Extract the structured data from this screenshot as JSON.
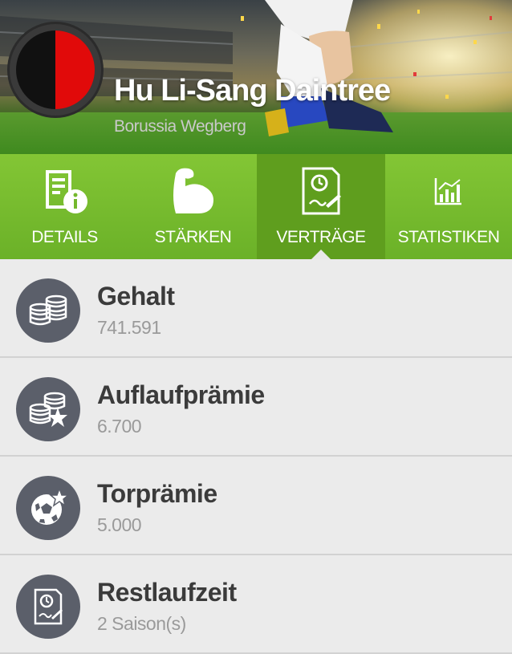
{
  "header": {
    "player_name": "Hu Li-Sang Daintree",
    "club_name": "Borussia Wegberg",
    "crest_colors": [
      "#111111",
      "#e10a0a"
    ]
  },
  "tabs": [
    {
      "label": "DETAILS",
      "icon": "document-info-icon",
      "active": false
    },
    {
      "label": "STÄRKEN",
      "icon": "flexed-bicep-icon",
      "active": false
    },
    {
      "label": "VERTRÄGE",
      "icon": "contract-clock-icon",
      "active": true
    },
    {
      "label": "STATISTIKEN",
      "icon": "bar-chart-icon",
      "active": false
    }
  ],
  "contract": {
    "items": [
      {
        "title": "Gehalt",
        "value": "741.591",
        "icon": "coins-icon"
      },
      {
        "title": "Auflaufprämie",
        "value": "6.700",
        "icon": "coins-star-icon"
      },
      {
        "title": "Torprämie",
        "value": "5.000",
        "icon": "ball-star-icon"
      },
      {
        "title": "Restlaufzeit",
        "value": "2 Saison(s)",
        "icon": "contract-clock-icon"
      }
    ]
  },
  "colors": {
    "tab_green": "#74b82d",
    "tab_active": "#5f9e1e",
    "icon_circle": "#5b5f6a",
    "title_text": "#3b3b3b",
    "value_text": "#9a9a9a"
  }
}
